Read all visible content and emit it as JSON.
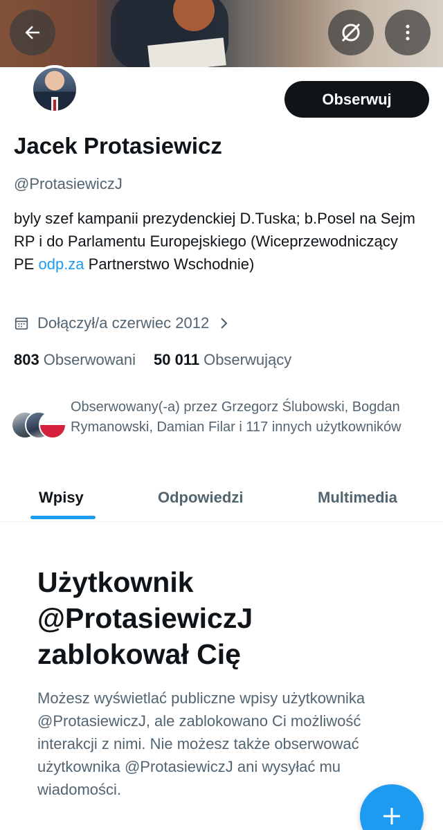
{
  "header": {
    "back_icon": "arrow-left-icon",
    "grok_icon": "grok-icon",
    "more_icon": "more-vertical-icon"
  },
  "profile": {
    "name": "Jacek Protasiewicz",
    "handle": "@ProtasiewiczJ",
    "follow_label": "Obserwuj",
    "bio_part1": "byly szef kampanii prezydenckiej D.Tuska; b.Posel na Sejm RP i do Parlamentu Europejskiego (Wiceprzewodniczący PE ",
    "bio_link": "odp.za",
    "bio_part2": " Partnerstwo Wschodnie)",
    "joined": "Dołączył/a czerwiec 2012",
    "following_count": "803",
    "following_label": "Obserwowani",
    "followers_count": "50 011",
    "followers_label": "Obserwujący",
    "followed_by": "Obserwowany(-a) przez Grzegorz Ślubowski, Bogdan Rymanowski, Damian Filar i 117 innych użytkowników"
  },
  "tabs": [
    {
      "label": "Wpisy",
      "active": true
    },
    {
      "label": "Odpowiedzi",
      "active": false
    },
    {
      "label": "Multimedia",
      "active": false
    }
  ],
  "blocked": {
    "title": "Użytkownik @ProtasiewiczJ zablokował Cię",
    "description": "Możesz wyświetlać publiczne wpisy użytkownika @ProtasiewiczJ, ale zablokowano Ci możliwość interakcji z nimi. Nie możesz także obserwować użytkownika @ProtasiewiczJ ani wysyłać mu wiadomości."
  },
  "colors": {
    "accent": "#1d9bf0",
    "text_primary": "#0f1419",
    "text_secondary": "#536471"
  },
  "fab_icon": "plus-icon"
}
